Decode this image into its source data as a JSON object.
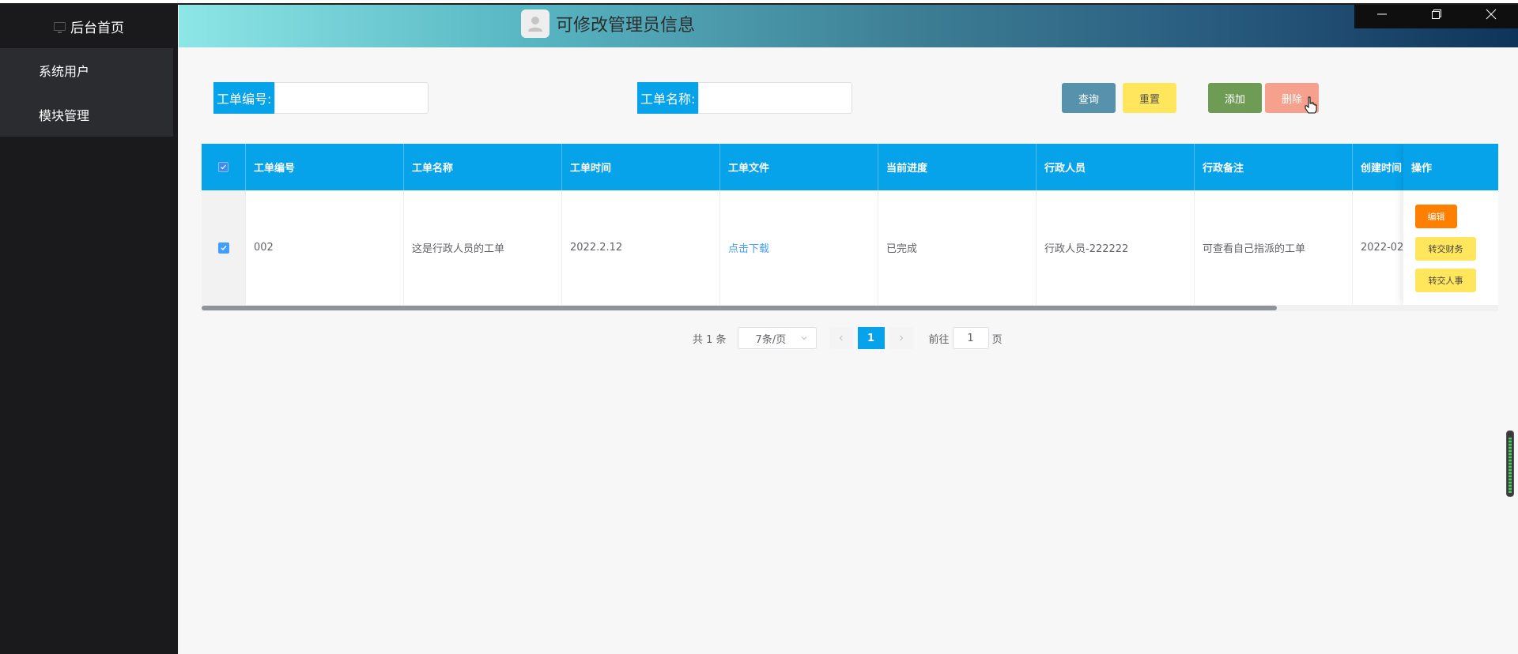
{
  "sidebar": {
    "home_label": "后台首页",
    "items": [
      {
        "label": "系统用户"
      },
      {
        "label": "模块管理"
      }
    ]
  },
  "header": {
    "title": "可修改管理员信息",
    "window_controls": [
      "minimize",
      "restore",
      "close"
    ]
  },
  "search": {
    "order_no_label": "工单编号:",
    "order_no_value": "",
    "order_name_label": "工单名称:",
    "order_name_value": ""
  },
  "actions": {
    "query": "查询",
    "reset": "重置",
    "add": "添加",
    "delete": "删除"
  },
  "table": {
    "columns": [
      "工单编号",
      "工单名称",
      "工单时间",
      "工单文件",
      "当前进度",
      "行政人员",
      "行政备注",
      "创建时间"
    ],
    "op_column": "操作",
    "rows": [
      {
        "selected": true,
        "order_no": "002",
        "order_name": "这是行政人员的工单",
        "order_time": "2022.2.12",
        "file": "点击下载",
        "progress": "已完成",
        "admin": "行政人员-222222",
        "remark": "可查看自己指派的工单",
        "created": "2022-02",
        "ops": {
          "edit": "编辑",
          "to_finance": "转交财务",
          "to_hr": "转交人事"
        }
      }
    ]
  },
  "pagination": {
    "total": "共 1 条",
    "page_size": "7条/页",
    "current_page": "1",
    "goto_prefix": "前往",
    "goto_value": "1",
    "goto_suffix": "页"
  },
  "colors": {
    "primary": "#06a3eb",
    "sidebar": "#1a1a1c",
    "query": "#5792ad",
    "reset": "#ffe65c",
    "add": "#6f9c55",
    "delete": "#f6a08e",
    "edit": "#ff7f00"
  }
}
